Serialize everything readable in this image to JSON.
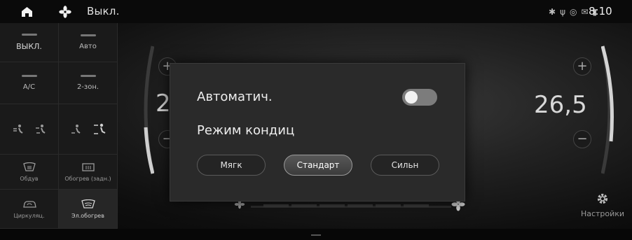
{
  "status_bar": {
    "fan_status": "Выкл.",
    "time": "8:10",
    "icons": [
      "home-icon",
      "fan-icon",
      "bluetooth-icon",
      "usb-icon",
      "signal-icon",
      "message-icon",
      "battery-icon"
    ]
  },
  "left_panel": {
    "off": "ВЫКЛ.",
    "auto": "Авто",
    "ac": "A/C",
    "dual": "2-зон.",
    "defrost_front": "Обдув",
    "defrost_rear": "Обогрев (задн.)",
    "recirc": "Циркуляц.",
    "heated_windshield": "Эл.обогрев"
  },
  "climate": {
    "temp_left": "2",
    "temp_right": "26,5",
    "plus": "+",
    "minus": "−"
  },
  "dialog": {
    "auto_label": "Автоматич.",
    "auto_enabled": false,
    "mode_label": "Режим кондиц",
    "modes": [
      "Мягк",
      "Стандарт",
      "Сильн"
    ],
    "selected_mode": "Стандарт"
  },
  "settings_label": "Настройки",
  "colors": {
    "background": "#0e0e0e",
    "dialog": "#2a2a2a",
    "toggle_off": "#7c7c7c",
    "arc_accent": "#c8c8c8"
  }
}
